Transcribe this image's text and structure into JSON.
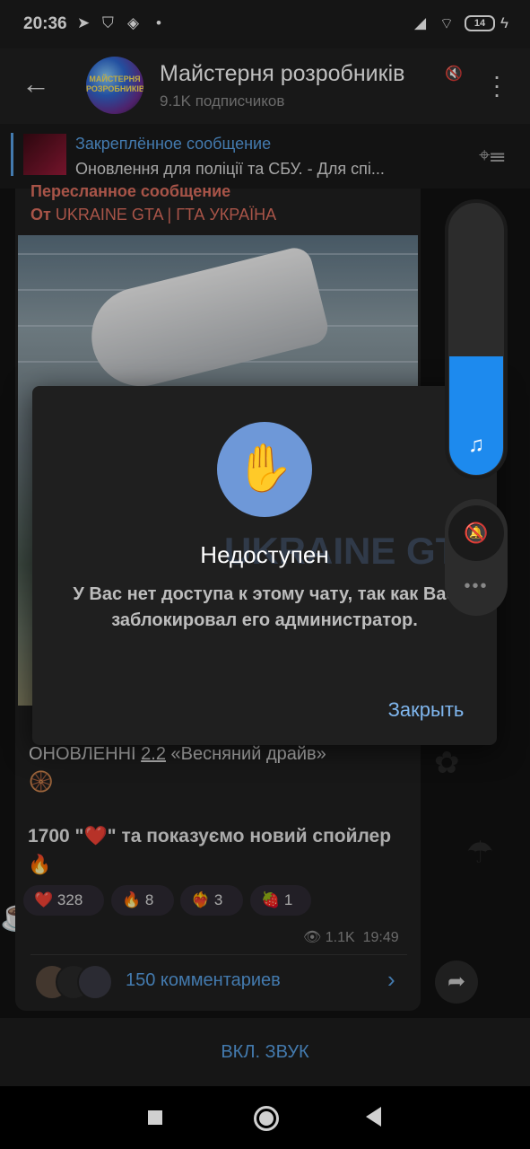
{
  "status_bar": {
    "time": "20:36",
    "battery": "14",
    "icons": [
      "telegram-icon",
      "shield-icon",
      "layers-icon",
      "dot-icon",
      "signal-icon",
      "wifi-icon",
      "battery-icon",
      "charging-icon"
    ]
  },
  "header": {
    "title": "Майстерня розробників",
    "subscribers": "9.1K подписчиков",
    "avatar_text": "МАЙСТЕРНЯ РОЗРОБНИКІВ"
  },
  "pinned": {
    "label": "Закреплённое сообщение",
    "text": "Оновлення для поліції та СБУ.  - Для спі..."
  },
  "message": {
    "forward_label": "Пересланное сообщение",
    "forward_from_prefix": "От",
    "forward_from_name": "UKRAINE GTA | ГТА УКРАЇНА",
    "text_line1_prefix": "ОНОВЛЕННІ",
    "text_line1_version": "2.2",
    "text_line1_suffix": "«Весняний драйв»",
    "text_emoji1": "🛞",
    "text_line2": "1700 \"❤️\" та показуємо новий спойлер 🔥",
    "reactions": [
      {
        "emoji": "❤️",
        "count": "328"
      },
      {
        "emoji": "🔥",
        "count": "8"
      },
      {
        "emoji": "❤️‍🔥",
        "count": "3"
      },
      {
        "emoji": "🍓",
        "count": "1"
      }
    ],
    "views": "1.1K",
    "time": "19:49",
    "comments": "150 комментариев"
  },
  "bottom": {
    "unmute": "ВКЛ. ЗВУК"
  },
  "dialog": {
    "title": "Недоступен",
    "body": "У Вас нет доступа к этому чату, так как Вас заблокировал его администратор.",
    "close": "Закрыть",
    "watermark": "UKRAINE GTA"
  },
  "volume": {
    "level_fraction": 0.45
  },
  "colors": {
    "accent": "#5aa3e8",
    "forward": "#e07060",
    "dialog_icon_bg": "#6e98d8",
    "volume_fill": "#1d8aee"
  }
}
